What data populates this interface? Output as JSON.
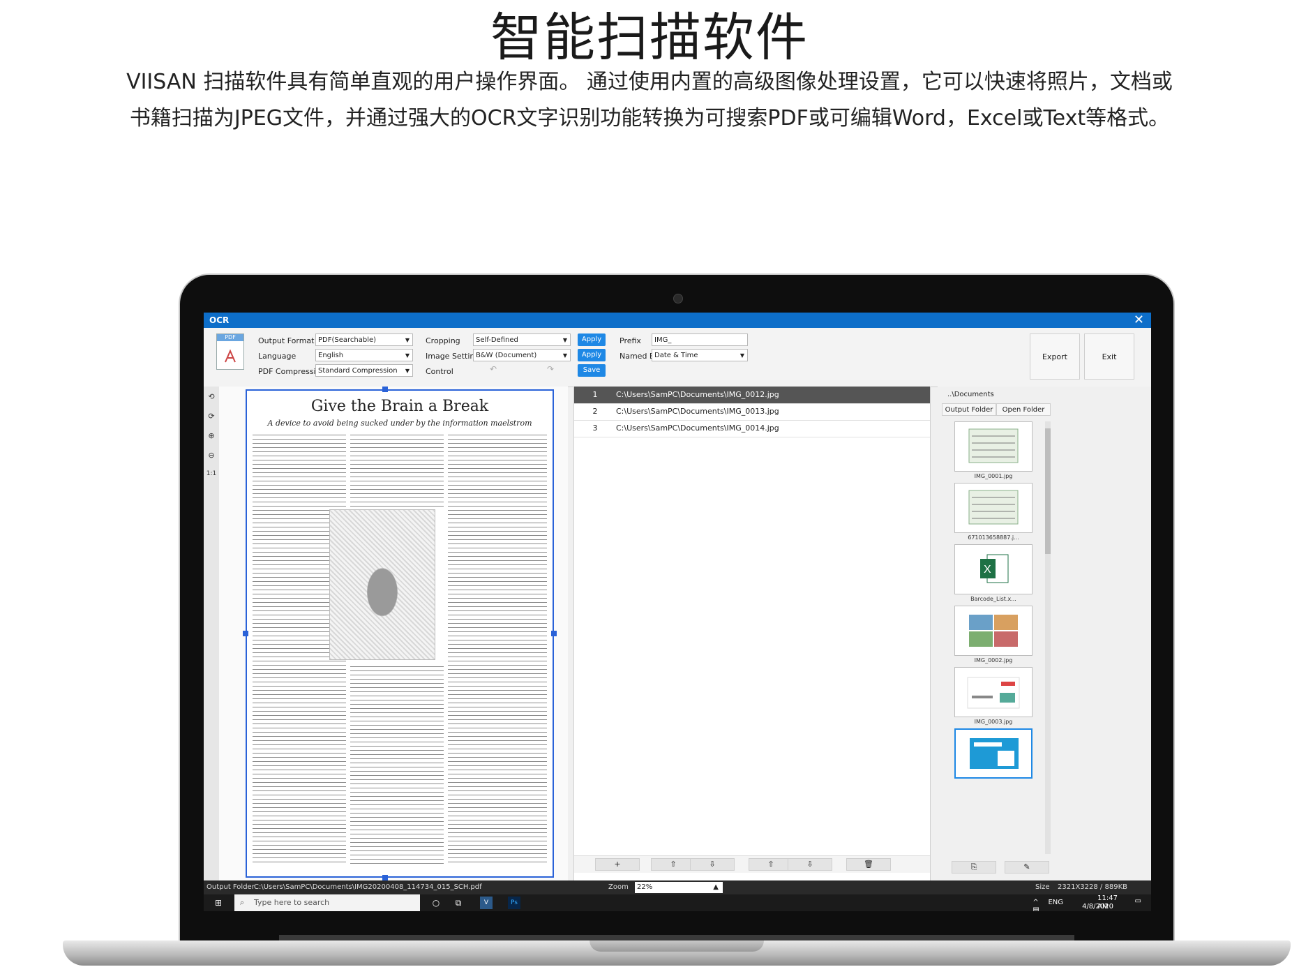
{
  "banner": {
    "headline": "智能扫描软件",
    "desc_line1": "VIISAN 扫描软件具有简单直观的用户操作界面。 通过使用内置的高级图像处理设置，它可以快速将照片，文档或",
    "desc_line2": "书籍扫描为JPEG文件，并通过强大的OCR文字识别功能转换为可搜索PDF或可编辑Word，Excel或Text等格式。"
  },
  "app": {
    "title": "OCR",
    "close": "✕",
    "pdf_icon_text": "PDF",
    "labels": {
      "output_format": "Output Format",
      "language": "Language",
      "pdf_compression": "PDF Compression",
      "cropping": "Cropping",
      "image_settings": "Image Settings",
      "control": "Control",
      "prefix": "Prefix",
      "named_by": "Named By"
    },
    "values": {
      "output_format": "PDF(Searchable)",
      "language": "English",
      "pdf_compression": "Standard Compression",
      "cropping": "Self-Defined",
      "image_settings": "B&W (Document)",
      "prefix": "IMG_",
      "named_by": "Date & Time"
    },
    "buttons": {
      "apply1": "Apply",
      "apply2": "Apply",
      "save": "Save",
      "export": "Export",
      "exit": "Exit"
    },
    "left_tools": [
      "⟲",
      "⟳",
      "⊕",
      "⊖",
      "1:1"
    ],
    "document": {
      "title": "Give the Brain a Break",
      "subtitle": "A device to avoid being sucked under by the information maelstrom"
    },
    "files": [
      {
        "n": "1",
        "path": "C:\\Users\\SamPC\\Documents\\IMG_0012.jpg"
      },
      {
        "n": "2",
        "path": "C:\\Users\\SamPC\\Documents\\IMG_0013.jpg"
      },
      {
        "n": "3",
        "path": "C:\\Users\\SamPC\\Documents\\IMG_0014.jpg"
      }
    ],
    "list_buttons": [
      "+",
      "⇧",
      "⇩",
      "⇧",
      "⇩",
      "🗑"
    ],
    "folder": {
      "path": "..\\Documents",
      "output_folder": "Output Folder",
      "open_folder": "Open Folder"
    },
    "thumbs": [
      {
        "caption": "IMG_0001.jpg"
      },
      {
        "caption": "671013658887.j..."
      },
      {
        "caption": "Barcode_List.x..."
      },
      {
        "caption": "IMG_0002.jpg"
      },
      {
        "caption": "IMG_0003.jpg"
      }
    ],
    "status": {
      "output_label": "Output Folder",
      "output_path": "C:\\Users\\SamPC\\Documents\\IMG20200408_114734_015_SCH.pdf",
      "zoom_label": "Zoom",
      "zoom_value": "22%",
      "size_label": "Size",
      "size_value": "2321X3228 / 889KB"
    }
  },
  "taskbar": {
    "search_placeholder": "Type here to search",
    "tray_lang": "ENG",
    "time": "11:47 AM",
    "date": "4/8/2020"
  }
}
